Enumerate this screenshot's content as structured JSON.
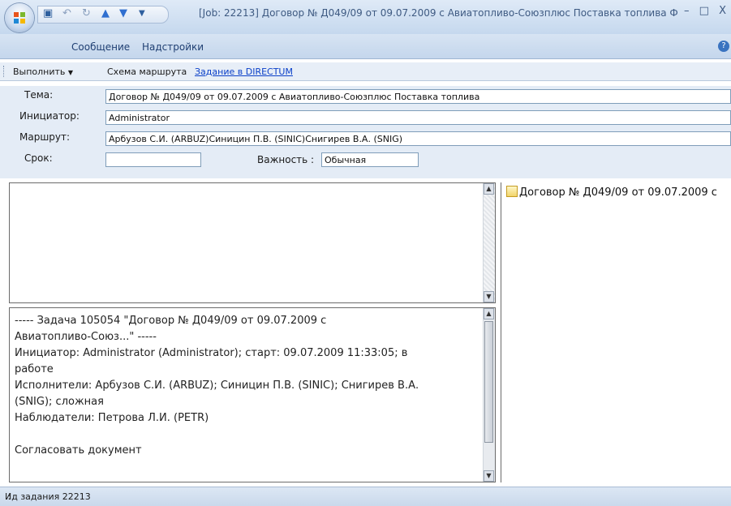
{
  "window": {
    "title": "[Job: 22213] Договор № Д049/09 от 09.07.2009 с Авиатопливо-Союзплюс Поставка топлива Ф",
    "controls": [
      "–",
      "□",
      "X"
    ]
  },
  "ribbon": {
    "tabs": [
      "Сообщение",
      "Надстройки"
    ]
  },
  "toolbar": {
    "execute_label": "Выполнить",
    "route_scheme_label": "Схема маршрута",
    "directum_link": "Задание в DIRECTUM"
  },
  "form": {
    "subject_label": "Тема:",
    "subject_value": "Договор № Д049/09 от 09.07.2009 с Авиатопливо-Союзплюс Поставка топлива",
    "initiator_label": "Инициатор:",
    "initiator_value": "Administrator",
    "route_label": "Маршрут:",
    "route_value": "Арбузов С.И. (ARBUZ)Синицин П.В. (SINIC)Снигирев В.А. (SNIG)",
    "deadline_label": "Срок:",
    "deadline_value": "",
    "importance_label": "Важность :",
    "importance_value": "Обычная"
  },
  "message_body": {
    "lines": [
      "----- Задача 105054 \"Договор № Д049/09 от 09.07.2009 с",
      "Авиатопливо-Союз...\" -----",
      "Инициатор: Administrator (Administrator); старт: 09.07.2009 11:33:05; в",
      "работе",
      "Исполнители: Арбузов С.И. (ARBUZ); Синицин П.В. (SINIC); Снигирев В.А.",
      "(SNIG); сложная",
      "Наблюдатели: Петрова Л.И. (PETR)",
      "",
      "Согласовать документ"
    ]
  },
  "attachments": [
    {
      "name": "Договор № Д049/09 от 09.07.2009 с",
      "icon": "document-attachment-icon"
    }
  ],
  "status_bar": {
    "text": "Ид задания 22213"
  }
}
